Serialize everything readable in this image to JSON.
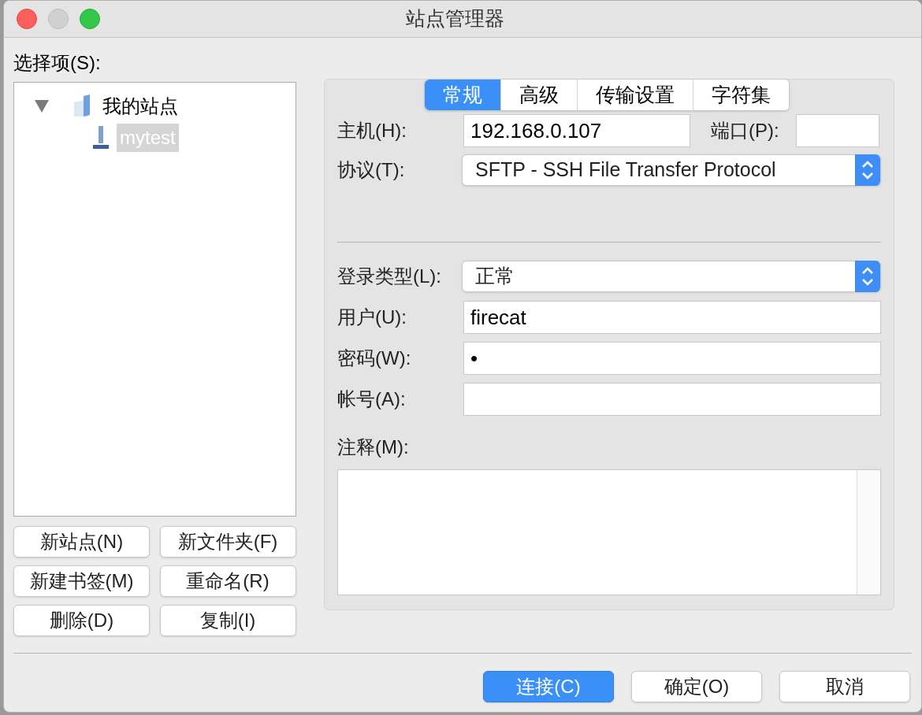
{
  "window": {
    "title": "站点管理器"
  },
  "site_tree": {
    "label": "选择项(S):",
    "items": [
      {
        "label": "我的站点",
        "kind": "folder",
        "expanded": true,
        "selected": false,
        "children": [
          {
            "label": "mytest",
            "kind": "site",
            "selected": true
          }
        ]
      }
    ]
  },
  "site_buttons": [
    "新站点(N)",
    "新文件夹(F)",
    "新建书签(M)",
    "重命名(R)",
    "删除(D)",
    "复制(I)"
  ],
  "tabs": [
    {
      "label": "常规",
      "selected": true
    },
    {
      "label": "高级",
      "selected": false
    },
    {
      "label": "传输设置",
      "selected": false
    },
    {
      "label": "字符集",
      "selected": false
    }
  ],
  "host": {
    "label": "主机(H):",
    "value": "192.168.0.107"
  },
  "port": {
    "label": "端口(P):"
  },
  "protocol": {
    "label": "协议(T):",
    "value": "SFTP - SSH File Transfer Protocol"
  },
  "logon_type": {
    "label": "登录类型(L):",
    "value": "正常"
  },
  "user": {
    "label": "用户(U):",
    "value": "firecat"
  },
  "password": {
    "label": "密码(W):",
    "value": "•"
  },
  "account": {
    "label": "帐号(A):"
  },
  "comments": {
    "label": "注释(M):"
  },
  "footer_buttons": [
    {
      "label": "连接(C)",
      "default": true
    },
    {
      "label": "确定(O)",
      "default": false
    },
    {
      "label": "取消",
      "default": false
    }
  ]
}
